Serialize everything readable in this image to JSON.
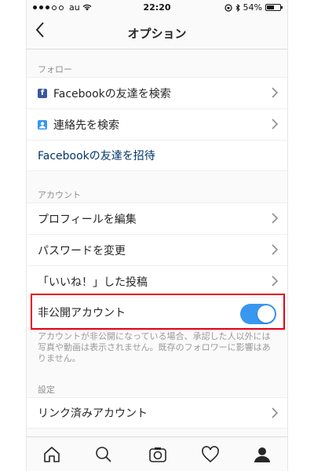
{
  "status_bar": {
    "carrier": "au",
    "time": "22:20",
    "battery": "54%",
    "battery_fraction": 0.54
  },
  "nav": {
    "back_icon": "chevron-left-icon",
    "title": "オプション"
  },
  "follow": {
    "header": "フォロー",
    "facebook_friends": "Facebookの友達を検索",
    "contacts": "連絡先を検索",
    "invite_facebook": "Facebookの友達を招待"
  },
  "account": {
    "header": "アカウント",
    "edit_profile": "プロフィールを編集",
    "change_password": "パスワードを変更",
    "liked_posts": "「いいね！」した投稿",
    "private_account": "非公開アカウント",
    "private_enabled": true,
    "private_note": "アカウントが非公開になっている場合、承認した人以外には写真や動画は表示されません。既存のフォロワーに影響はありません。"
  },
  "settings": {
    "header": "設定",
    "linked_accounts": "リンク済みアカウント"
  },
  "colors": {
    "toggle_on": "#3897f0",
    "highlight": "#e60012",
    "facebook": "#3b5998"
  },
  "tabbar": [
    "home-icon",
    "search-icon",
    "camera-icon",
    "heart-icon",
    "profile-icon"
  ]
}
